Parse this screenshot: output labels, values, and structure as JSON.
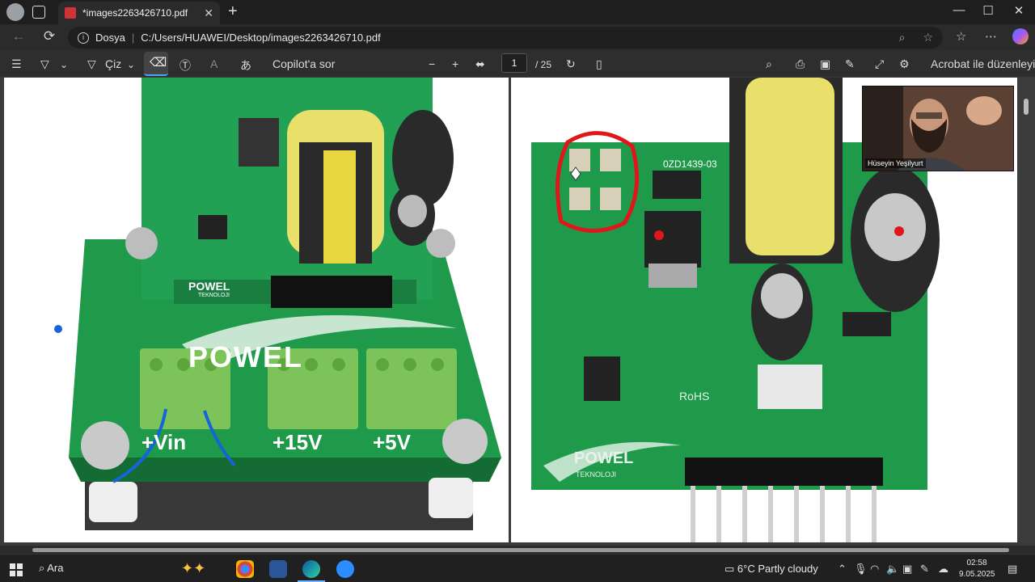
{
  "browser": {
    "tab_title": "*images2263426710.pdf",
    "tab_close": "✕",
    "new_tab": "+",
    "address_label": "Dosya",
    "address_url": "C:/Users/HUAWEI/Desktop/images2263426710.pdf",
    "window_controls": {
      "minimize": "—",
      "maximize": "☐",
      "close": "✕"
    }
  },
  "pdf_toolbar": {
    "draw_label": "Çiz",
    "copilot_label": "Copilot'a sor",
    "current_page": "1",
    "total_pages": "/ 25",
    "acrobat_label": "Acrobat ile düzenleyin",
    "read_aloud_glyph": "あ",
    "zoom_out": "−",
    "zoom_in": "+"
  },
  "document": {
    "left_page_labels": {
      "vin": "+Vin",
      "v15": "+15V",
      "v5": "+5V",
      "brand": "POWEL",
      "sub": "TEKNOLOJI"
    },
    "right_page_labels": {
      "brand": "POWEL",
      "sub": "TEKNOLOJI",
      "chip": "0ZD1439-03",
      "rohs": "RoHS"
    }
  },
  "video_overlay": {
    "participant_name": "Hüseyin Yeşilyurt"
  },
  "taskbar": {
    "search_label": "Ara",
    "weather": "6°C  Partly cloudy",
    "time": "02:58",
    "date": "9.05.2025"
  },
  "colors": {
    "pcb_green": "#1f9a4a",
    "annotation_red": "#e0161b",
    "annotation_blue": "#1565d8",
    "terminal_green": "#7cc45a"
  }
}
